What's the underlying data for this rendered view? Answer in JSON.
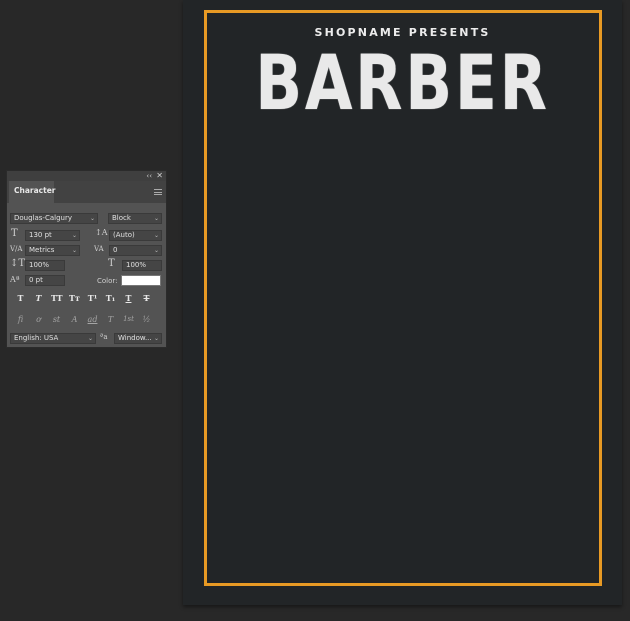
{
  "document": {
    "subtitle": "SHOPNAME PRESENTS",
    "headline": "BARBER",
    "border_color": "#e89a24",
    "background_color": "#222527"
  },
  "panel": {
    "tab": "Character",
    "collapse_icon": "collapse-icon",
    "close_icon": "close-icon",
    "font_family": "Douglas-Calgury",
    "font_style": "Block",
    "font_size": "130 pt",
    "leading": "(Auto)",
    "kerning": "Metrics",
    "tracking": "0",
    "vertical_scale": "100%",
    "horizontal_scale": "100%",
    "baseline_shift": "0 pt",
    "color_label": "Color:",
    "color_value": "#ffffff",
    "style_buttons": [
      "T",
      "T",
      "TT",
      "Tт",
      "T¹",
      "T₁",
      "T",
      "T"
    ],
    "opentype_buttons": [
      "fi",
      "ơ",
      "st",
      "A",
      "ad",
      "T",
      "1st",
      "½"
    ],
    "language": "English: USA",
    "antialias_icon": "aa-icon",
    "antialias": "Window..."
  }
}
